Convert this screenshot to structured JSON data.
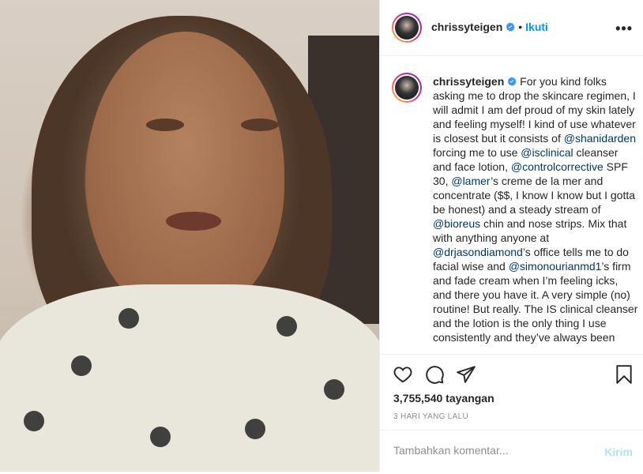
{
  "post": {
    "username": "chrissyteigen",
    "follow_label": "Ikuti",
    "dot": "•",
    "more_label": "•••",
    "caption_segments": [
      {
        "t": "For you kind folks asking me to drop the skincare regimen, I will admit I am def proud of my skin lately and feeling myself! I kind of use whatever is closest but it consists of ",
        "m": false
      },
      {
        "t": "@shanidarden",
        "m": true
      },
      {
        "t": " forcing me to use ",
        "m": false
      },
      {
        "t": "@isclinical",
        "m": true
      },
      {
        "t": " cleanser and face lotion, ",
        "m": false
      },
      {
        "t": "@controlcorrective",
        "m": true
      },
      {
        "t": " SPF 30, ",
        "m": false
      },
      {
        "t": "@lamer",
        "m": true
      },
      {
        "t": "’s creme de la mer and concentrate ($$, I know I know but I gotta be honest) and a steady stream of ",
        "m": false
      },
      {
        "t": "@bioreus",
        "m": true
      },
      {
        "t": " chin and nose strips. Mix that with anything anyone at ",
        "m": false
      },
      {
        "t": "@drjasondiamond",
        "m": true
      },
      {
        "t": "’s office tells me to do facial wise and ",
        "m": false
      },
      {
        "t": "@simonourianmd1",
        "m": true
      },
      {
        "t": "’s firm and fade cream when I’m feeling icks, and there you have it. A very simple (no) routine! But really. The IS clinical cleanser and the lotion is the only thing I use consistently and they’ve always been",
        "m": false
      }
    ],
    "views": "3,755,540 tayangan",
    "time_ago": "3 HARI YANG LALU"
  },
  "comment": {
    "placeholder": "Tambahkan komentar...",
    "send_label": "Kirim"
  },
  "icons": {
    "like": "heart-icon",
    "comment": "comment-icon",
    "share": "send-icon",
    "save": "bookmark-icon",
    "verified": "verified-badge-icon"
  },
  "colors": {
    "accent": "#0095f6",
    "mention": "#00376b",
    "verified": "#3897f0",
    "send_disabled": "#b2dffc",
    "muted": "#8e8e8e"
  }
}
